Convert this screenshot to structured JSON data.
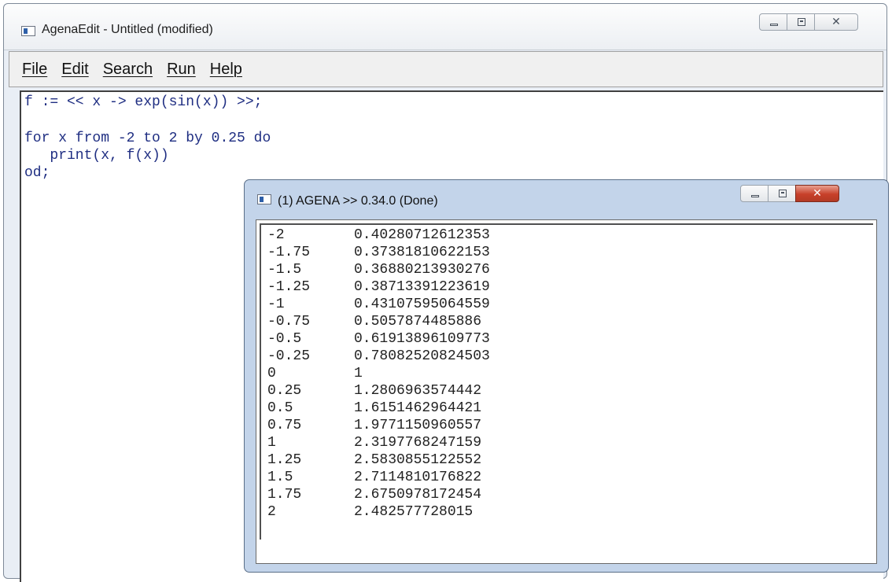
{
  "main_window": {
    "title": "AgenaEdit - Untitled (modified)",
    "controls": {
      "minimize": "—",
      "maximize": "□",
      "close": "✕"
    }
  },
  "menu": {
    "items": [
      {
        "label": "File"
      },
      {
        "label": "Edit"
      },
      {
        "label": "Search"
      },
      {
        "label": "Run"
      },
      {
        "label": "Help"
      }
    ]
  },
  "editor": {
    "lines": [
      "f := << x -> exp(sin(x)) >>;",
      "",
      "for x from -2 to 2 by 0.25 do",
      "   print(x, f(x))",
      "od;"
    ]
  },
  "output_window": {
    "title": "(1) AGENA >> 0.34.0 (Done)",
    "controls": {
      "minimize": "—",
      "maximize": "□",
      "close": "✕"
    },
    "rows": [
      {
        "x": "-2",
        "y": "0.40280712612353"
      },
      {
        "x": "-1.75",
        "y": "0.37381810622153"
      },
      {
        "x": "-1.5",
        "y": "0.36880213930276"
      },
      {
        "x": "-1.25",
        "y": "0.38713391223619"
      },
      {
        "x": "-1",
        "y": "0.43107595064559"
      },
      {
        "x": "-0.75",
        "y": "0.5057874485886"
      },
      {
        "x": "-0.5",
        "y": "0.61913896109773"
      },
      {
        "x": "-0.25",
        "y": "0.78082520824503"
      },
      {
        "x": "0",
        "y": "1"
      },
      {
        "x": "0.25",
        "y": "1.2806963574442"
      },
      {
        "x": "0.5",
        "y": "1.6151462964421"
      },
      {
        "x": "0.75",
        "y": "1.9771150960557"
      },
      {
        "x": "1",
        "y": "2.3197768247159"
      },
      {
        "x": "1.25",
        "y": "2.5830855122552"
      },
      {
        "x": "1.5",
        "y": "2.7114810176822"
      },
      {
        "x": "1.75",
        "y": "2.6750978172454"
      },
      {
        "x": "2",
        "y": "2.482577728015"
      }
    ]
  }
}
